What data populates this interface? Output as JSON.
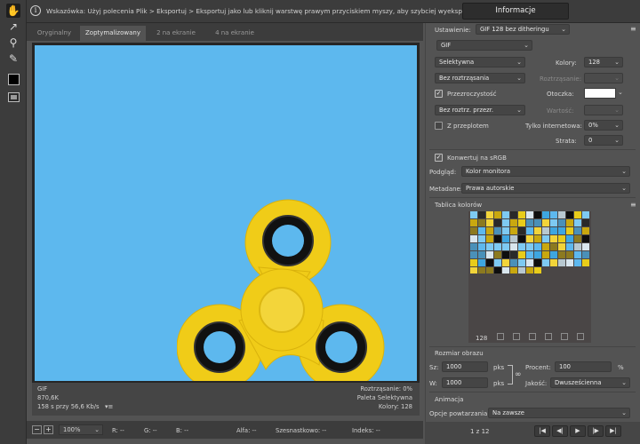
{
  "hint": {
    "text": "Wskazówka: Użyj polecenia Plik > Eksportuj > Eksportuj jako lub kliknij warstwę prawym przyciskiem myszy, aby szybciej wyeksportować zasoby.",
    "info_button": "Informacje"
  },
  "tools": [
    "hand-icon",
    "slice-select-icon",
    "zoom-icon",
    "eyedropper-icon",
    "color-swatch-icon",
    "toggle-slices-icon"
  ],
  "tabs": [
    {
      "label": "Oryginalny",
      "active": false
    },
    {
      "label": "Zoptymalizowany",
      "active": true
    },
    {
      "label": "2 na ekranie",
      "active": false
    },
    {
      "label": "4 na ekranie",
      "active": false
    }
  ],
  "canvas": {
    "background": "#5db8ee",
    "spinner_color": "#f0cc18",
    "left_info": [
      "GIF",
      "870,6K",
      "158 s przy 56,6 Kb/s"
    ],
    "right_info": [
      "Roztrząsanie: 0%",
      "Paleta Selektywna",
      "Kolory: 128"
    ]
  },
  "status": {
    "zoom": "100%",
    "r": "R: --",
    "g": "G: --",
    "b": "B: --",
    "alpha": "Alfa: --",
    "hex": "Szesnastkowo: --",
    "index": "Indeks: --"
  },
  "panel": {
    "preset_label": "Ustawienie:",
    "preset_value": "GIF 128 bez ditheringu",
    "format": "GIF",
    "reduction": "Selektywna",
    "colors_label": "Kolory:",
    "colors_value": "128",
    "dither": "Bez roztrząsania",
    "dither_amount_label": "Roztrząsanie:",
    "transparency_label": "Przezroczystość",
    "transparency_checked": true,
    "matte_label": "Otoczka:",
    "matte_color": "#ffffff",
    "transparency_dither": "Bez roztrz. przezr.",
    "amount_label": "Wartość:",
    "interlaced_label": "Z przeplotem",
    "interlaced_checked": false,
    "websnap_label": "Tylko internetowa:",
    "websnap_value": "0%",
    "lossy_label": "Strata:",
    "lossy_value": "0",
    "srgb_label": "Konwertuj na sRGB",
    "srgb_checked": true,
    "preview_label": "Podgląd:",
    "preview_value": "Kolor monitora",
    "metadata_label": "Metadane:",
    "metadata_value": "Prawa autorskie",
    "color_table_label": "Tablica kolorów",
    "color_count": "128",
    "image_size_label": "Rozmiar obrazu",
    "width_label": "Sz:",
    "width_value": "1000",
    "height_label": "W:",
    "height_value": "1000",
    "unit": "pks",
    "percent_label": "Procent:",
    "percent_value": "100",
    "percent_unit": "%",
    "quality_label": "Jakość:",
    "quality_value": "Dwusześcienna",
    "animation_label": "Animacja",
    "loop_label": "Opcje powtarzania:",
    "loop_value": "Na zawsze",
    "frame_counter": "1 z 12"
  }
}
